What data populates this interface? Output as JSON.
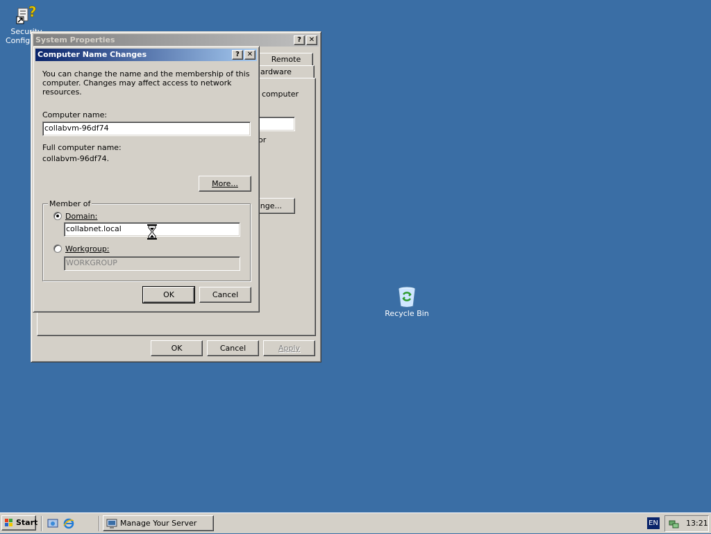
{
  "desktop": {
    "security_icon_label_line1": "Security",
    "security_icon_label_line2": "Configu",
    "recycle_bin_label": "Recycle Bin",
    "background_color": "#3a6ea5"
  },
  "system_properties": {
    "title": "System Properties",
    "help_btn": "?",
    "close_btn": "✕",
    "tab_remote": "Remote",
    "tab_hardware_partial": "ardware",
    "text_computer_partial": "computer",
    "text_or_partial": "or",
    "change_btn_partial": "ange...",
    "ok_label": "OK",
    "cancel_label": "Cancel",
    "apply_label": "Apply"
  },
  "dialog": {
    "title": "Computer Name Changes",
    "help_btn": "?",
    "close_btn": "✕",
    "intro_line1": "You can change the name and the membership of this",
    "intro_line2": "computer. Changes may affect access to network resources.",
    "computer_name_label": "Computer name:",
    "computer_name_value": "collabvm-96df74",
    "full_name_label": "Full computer name:",
    "full_name_value": "collabvm-96df74.",
    "more_label": "More...",
    "member_of_label": "Member of",
    "domain_label": "Domain:",
    "domain_value": "collabnet.local",
    "workgroup_label": "Workgroup:",
    "workgroup_value": "WORKGROUP",
    "ok_label": "OK",
    "cancel_label": "Cancel",
    "selected_membership": "domain"
  },
  "taskbar": {
    "start_label": "Start",
    "task_manage_label": "Manage Your Server",
    "lang_label": "EN",
    "clock": "13:21"
  },
  "colors": {
    "title_active_start": "#0a246a",
    "title_active_end": "#a6caf0",
    "window_face": "#d4d0c8"
  }
}
